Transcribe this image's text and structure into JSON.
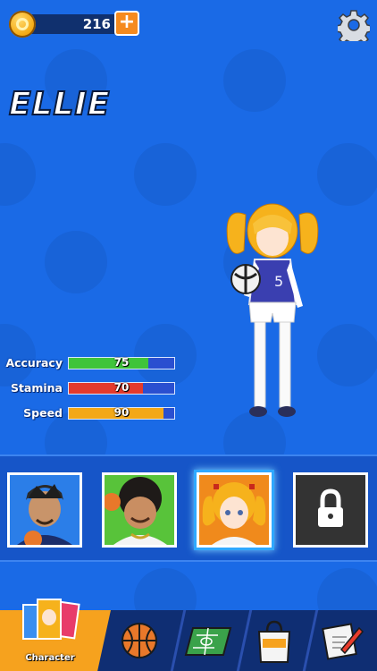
{
  "top_bar": {
    "coin_count": "216",
    "plus_label": "+"
  },
  "character": {
    "name": "ELLIE"
  },
  "stats": [
    {
      "label": "Accuracy",
      "value": "75",
      "level": 0.75,
      "color": "#3fc43a"
    },
    {
      "label": "Stamina",
      "value": "70",
      "level": 0.7,
      "color": "#e43a2c"
    },
    {
      "label": "Speed",
      "value": "90",
      "level": 0.9,
      "color": "#f3a818"
    }
  ],
  "roster": [
    {
      "name": "player-1",
      "bg": "#2b7ee8",
      "locked": false,
      "selected": false
    },
    {
      "name": "player-2",
      "bg": "#58c33a",
      "locked": false,
      "selected": false
    },
    {
      "name": "ellie",
      "bg": "#f08a1c",
      "locked": false,
      "selected": true
    },
    {
      "name": "locked",
      "bg": "#333333",
      "locked": true,
      "selected": false
    }
  ],
  "nav": {
    "character_label": "Character",
    "items": [
      "character",
      "basketball",
      "court",
      "shop",
      "notes"
    ],
    "active": "character",
    "active_color": "#f6a21e"
  },
  "icons": {
    "coin": "coin-icon",
    "gear": "gear-icon",
    "lock": "lock-icon",
    "basketball": "basketball-icon",
    "court": "court-icon",
    "shop": "shopping-bag-icon",
    "notes": "note-pencil-icon"
  }
}
